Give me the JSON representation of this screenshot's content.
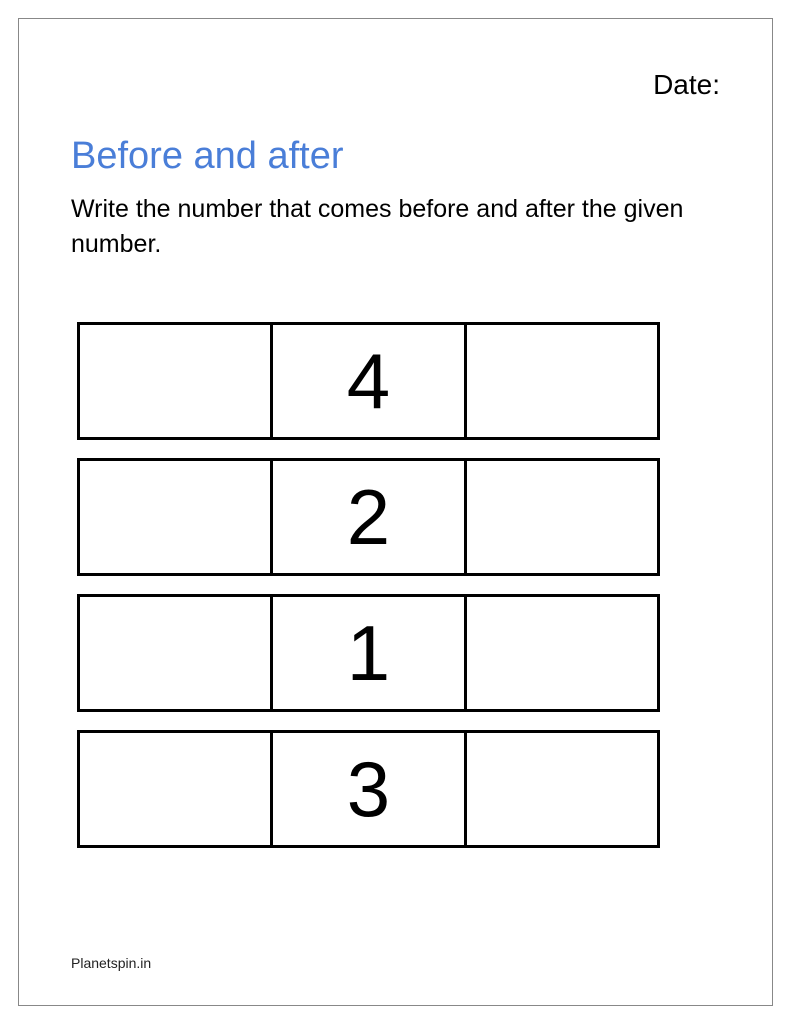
{
  "header": {
    "date_label": "Date:"
  },
  "title": "Before and after",
  "instruction": "Write the number that comes before and after the given number.",
  "rows": [
    {
      "before": "",
      "middle": "4",
      "after": ""
    },
    {
      "before": "",
      "middle": "2",
      "after": ""
    },
    {
      "before": "",
      "middle": "1",
      "after": ""
    },
    {
      "before": "",
      "middle": "3",
      "after": ""
    }
  ],
  "footer": "Planetspin.in"
}
